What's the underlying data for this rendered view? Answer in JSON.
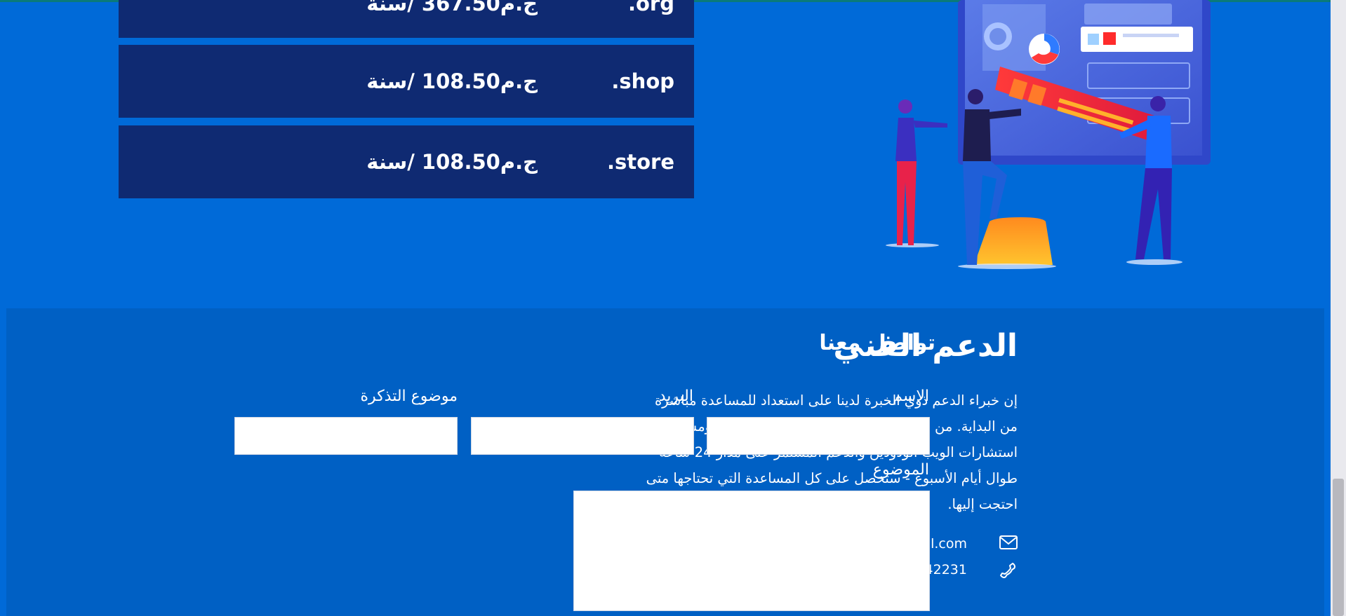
{
  "domains": [
    {
      "ext": ".org",
      "price": "ج.م367.50 /سنة"
    },
    {
      "ext": ".shop",
      "price": "ج.م108.50 /سنة"
    },
    {
      "ext": ".store",
      "price": "ج.م108.50 /سنة"
    }
  ],
  "support": {
    "title": "الدعم الفني",
    "text": "إن خبراء الدعم ذوي الخبرة لدينا على استعداد للمساعدة مباشرة من البداية. من خلال عمليات الترحيل المجانية للموقع، ومساعدي استشارات الويب الودودين والدعم المستمر على مدار 24 ساعة طوال أيام الأسبوع - ستحصل على كل المساعدة التي تحتاجها متى احتجت إليها.",
    "email": "omarTorky@gmail.com",
    "phone": "+20 1144842231",
    "email_icon": "envelope-icon",
    "phone_icon": "phone-icon"
  },
  "contact": {
    "title": "تواصل معنا",
    "name_label": "الاسم",
    "email_label": "البريد",
    "ticket_label": "موضوع التذكرة",
    "subject_label": "الموضوع",
    "name_value": "",
    "email_value": "",
    "ticket_value": "",
    "subject_value": ""
  },
  "colors": {
    "page_bg": "#006ad8",
    "row_bg": "#0f2a72",
    "footer_bg": "#0060c4"
  },
  "illustration": "team-building-dashboard-illustration"
}
